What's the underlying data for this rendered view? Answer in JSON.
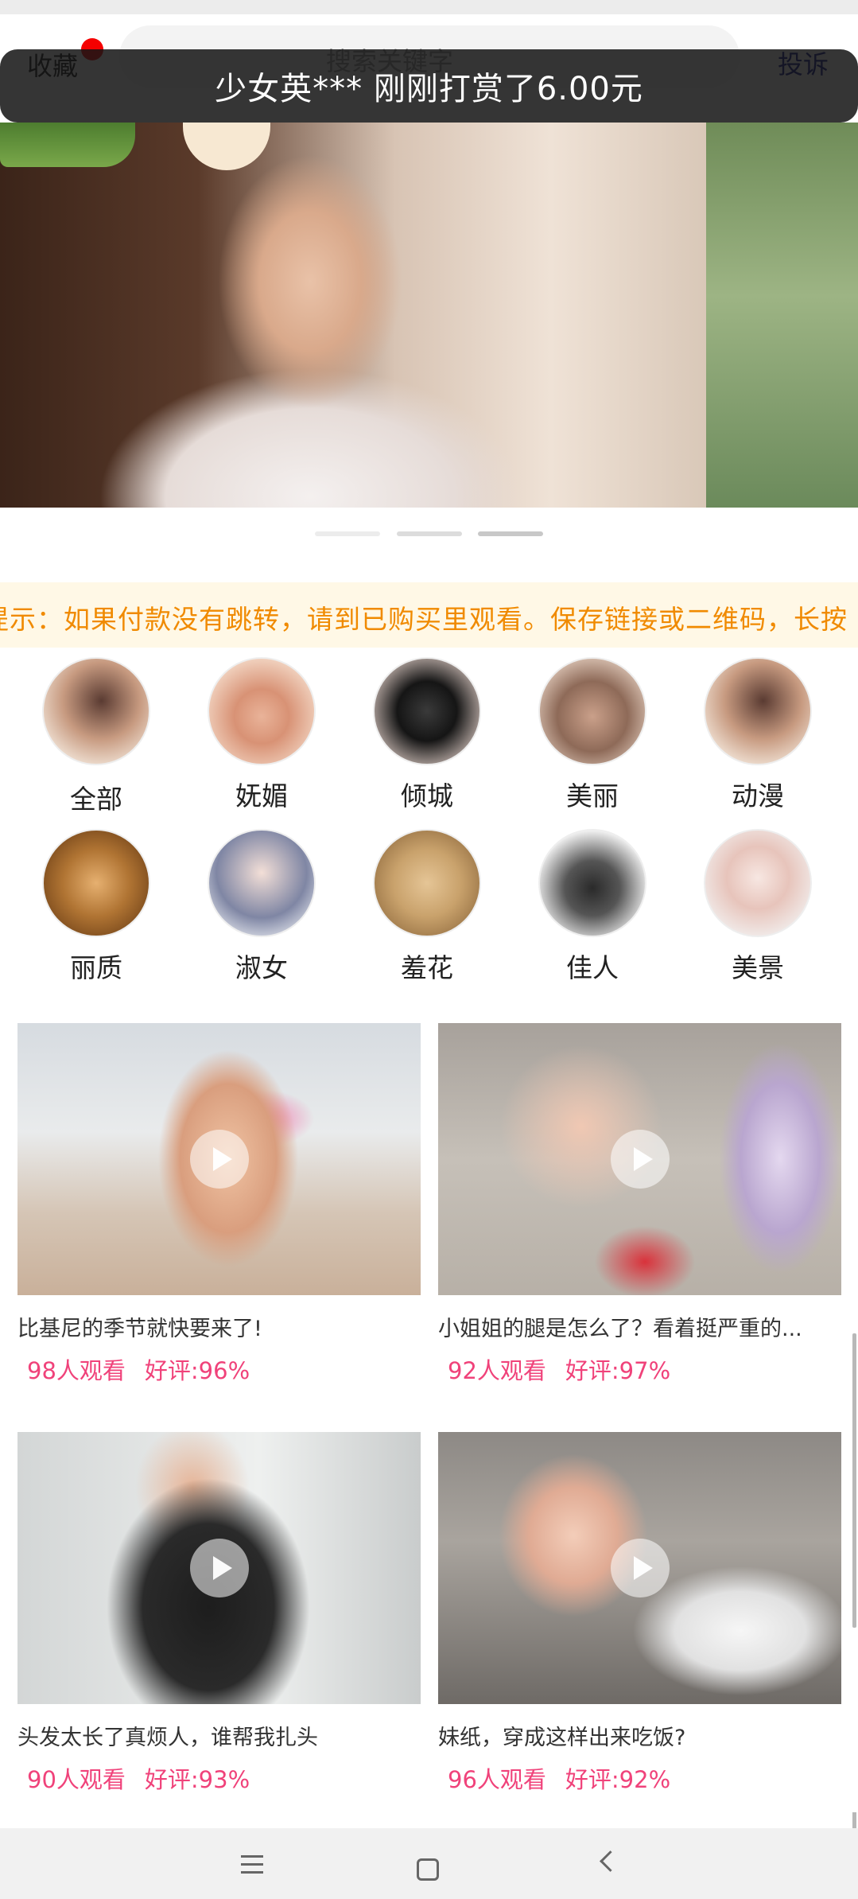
{
  "header": {
    "favorite_label": "收藏",
    "search_placeholder": "搜索关键字",
    "report_label": "投诉"
  },
  "toast": {
    "message": "少女英*** 刚刚打赏了6.00元"
  },
  "carousel": {
    "slide_count": 3,
    "active_index": 2
  },
  "notice": {
    "text": "提示：如果付款没有跳转，请到已购买里观看。保存链接或二维码，长按"
  },
  "categories": [
    {
      "label": "全部",
      "icon": "category-thumb"
    },
    {
      "label": "妩媚",
      "icon": "category-thumb"
    },
    {
      "label": "倾城",
      "icon": "category-thumb"
    },
    {
      "label": "美丽",
      "icon": "category-thumb"
    },
    {
      "label": "动漫",
      "icon": "category-thumb"
    },
    {
      "label": "丽质",
      "icon": "category-thumb"
    },
    {
      "label": "淑女",
      "icon": "category-thumb"
    },
    {
      "label": "羞花",
      "icon": "category-thumb"
    },
    {
      "label": "佳人",
      "icon": "category-thumb"
    },
    {
      "label": "美景",
      "icon": "category-thumb"
    }
  ],
  "videos": [
    {
      "title": "比基尼的季节就快要来了!",
      "views": "98人观看",
      "rating": "好评:96%"
    },
    {
      "title": "小姐姐的腿是怎么了？看着挺严重的...",
      "views": "92人观看",
      "rating": "好评:97%"
    },
    {
      "title": "头发太长了真烦人，谁帮我扎头",
      "views": "90人观看",
      "rating": "好评:93%"
    },
    {
      "title": "妹纸，穿成这样出来吃饭?",
      "views": "96人观看",
      "rating": "好评:92%"
    }
  ],
  "colors": {
    "accent_pink": "#f0427a",
    "notice_orange": "#f08a00",
    "notice_bg": "#fff8e6",
    "report_blue": "#1b1f8f",
    "badge_red": "#f50000"
  },
  "nav": {
    "icons": [
      "menu-icon",
      "home-icon",
      "back-icon"
    ]
  }
}
